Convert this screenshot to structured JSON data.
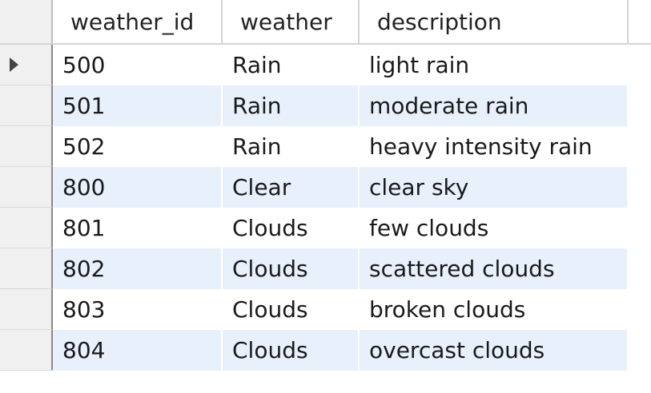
{
  "columns": {
    "weather_id": "weather_id",
    "weather": "weather",
    "description": "description"
  },
  "current_row_index": 0,
  "rows": [
    {
      "weather_id": "500",
      "weather": "Rain",
      "description": "light rain"
    },
    {
      "weather_id": "501",
      "weather": "Rain",
      "description": "moderate rain"
    },
    {
      "weather_id": "502",
      "weather": "Rain",
      "description": "heavy intensity rain"
    },
    {
      "weather_id": "800",
      "weather": "Clear",
      "description": "clear sky"
    },
    {
      "weather_id": "801",
      "weather": "Clouds",
      "description": "few clouds"
    },
    {
      "weather_id": "802",
      "weather": "Clouds",
      "description": "scattered clouds"
    },
    {
      "weather_id": "803",
      "weather": "Clouds",
      "description": "broken clouds"
    },
    {
      "weather_id": "804",
      "weather": "Clouds",
      "description": "overcast clouds"
    }
  ],
  "colors": {
    "alternate_row": "#e8f0fb",
    "row_header": "#f0f0f0"
  },
  "icons": {
    "current_row": "current-row-arrow-icon"
  }
}
